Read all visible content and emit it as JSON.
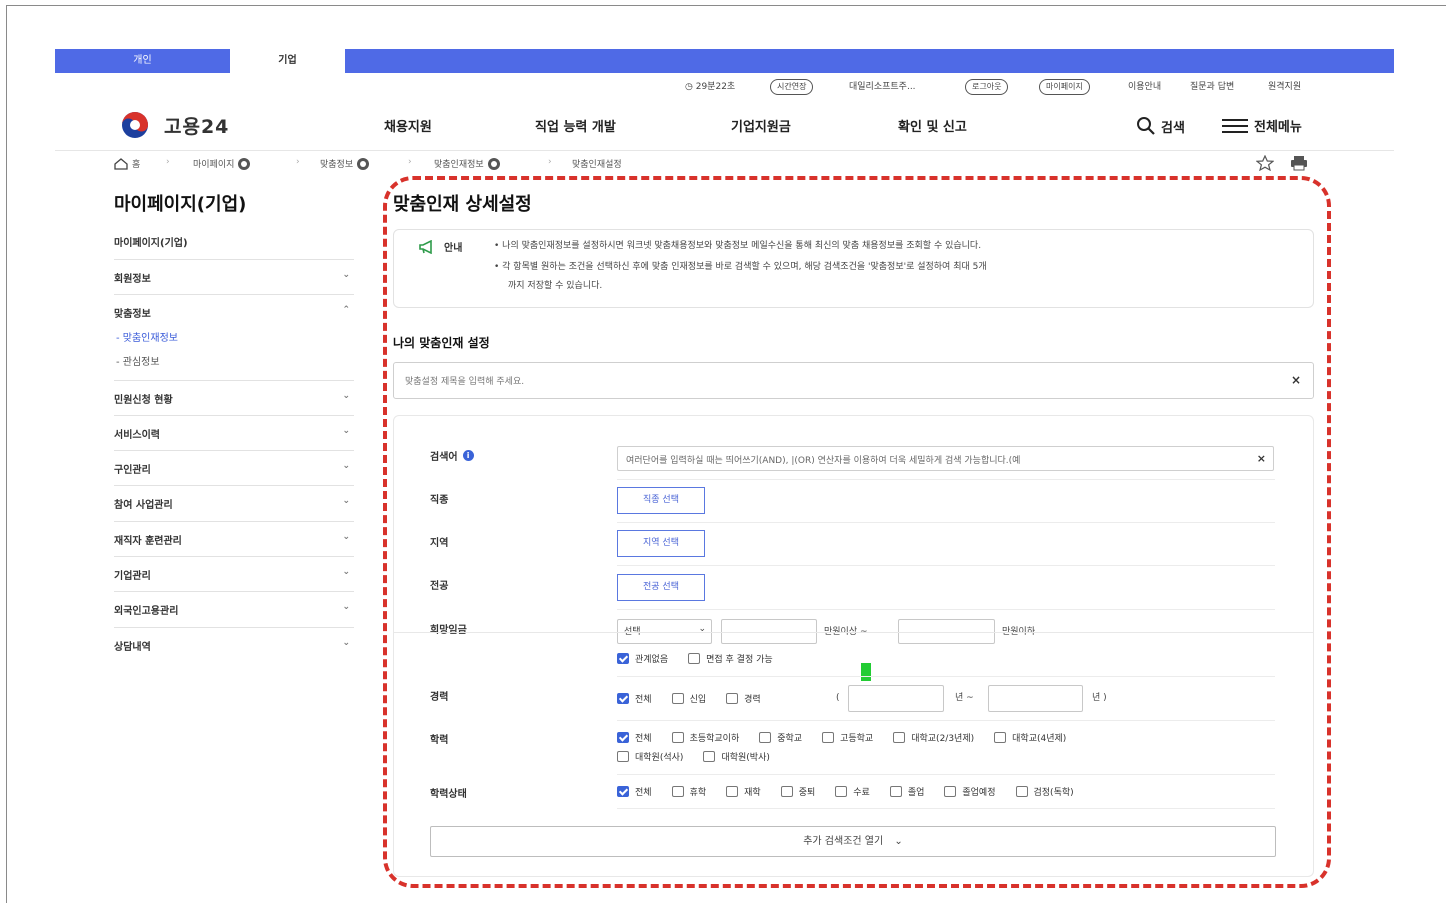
{
  "tabs": {
    "personal": "개인",
    "company": "기업"
  },
  "utility": {
    "timer": "29분22초",
    "extend": "시간연장",
    "company_name": "대일리소프트주...",
    "logout": "로그아웃",
    "mypage": "마이페이지",
    "guide": "이용안내",
    "qna": "질문과 답변",
    "remote": "원격지원"
  },
  "header": {
    "logo_text": "고용24",
    "nav": [
      "채용지원",
      "직업 능력 개발",
      "기업지원금",
      "확인 및 신고"
    ],
    "search": "검색",
    "all_menu": "전체메뉴"
  },
  "breadcrumb": [
    "홈",
    "마이페이지",
    "맞춤정보",
    "맞춤인재정보",
    "맞춤인재설정"
  ],
  "sidebar": {
    "title": "마이페이지(기업)",
    "sub": "마이페이지(기업)",
    "items": [
      "회원정보",
      "맞춤정보",
      "민원신청 현황",
      "서비스이력",
      "구인관리",
      "참여 사업관리",
      "재직자 훈련관리",
      "기업관리",
      "외국인고용관리",
      "상담내역"
    ],
    "children": [
      "- 맞춤인재정보",
      "- 관심정보"
    ]
  },
  "main": {
    "title": "맞춤인재 상세설정",
    "notice_label": "안내",
    "notice_lines": [
      "• 나의 맞춤인재정보를 설정하시면 워크넷 맞춤채용정보와 맞춤정보 메일수신을 통해 최신의 맞춤 채용정보를 조회할 수 있습니다.",
      "• 각 항목별 원하는 조건을 선택하신 후에 맞춤 인재정보를 바로 검색할 수 있으며, 해당 검색조건을 '맞춤정보'로 설정하여 최대 5개",
      "까지 저장할 수 있습니다."
    ],
    "section_title": "나의 맞춤인재 설정",
    "title_placeholder": "맞춤설정 제목을 입력해 주세요.",
    "labels": {
      "keyword": "검색어",
      "job": "직종",
      "region": "지역",
      "major": "전공",
      "salary": "희망임금",
      "career": "경력",
      "education": "학력",
      "edu_status": "학력상태"
    },
    "keyword_placeholder": "여러단어를 입력하실 때는 띄어쓰기(AND), |(OR) 연산자를 이용하여 더욱 세밀하게 검색 가능합니다.(예",
    "job_btn": "직종 선택",
    "region_btn": "지역 선택",
    "major_btn": "전공 선택",
    "salary": {
      "select": "선택",
      "from_suffix": "만원이상 ~",
      "to_suffix": "만원이하"
    },
    "salary_checks": [
      {
        "label": "관계없음",
        "checked": true
      },
      {
        "label": "면접 후 결정 가능",
        "checked": false
      }
    ],
    "career_checks": [
      {
        "label": "전체",
        "checked": true
      },
      {
        "label": "신입",
        "checked": false
      },
      {
        "label": "경력",
        "checked": false
      }
    ],
    "career_range": {
      "open": "(",
      "year1": "년 ~",
      "year2": "년 )"
    },
    "edu_checks": [
      {
        "label": "전체",
        "checked": true
      },
      {
        "label": "초등학교이하",
        "checked": false
      },
      {
        "label": "중학교",
        "checked": false
      },
      {
        "label": "고등학교",
        "checked": false
      },
      {
        "label": "대학교(2/3년제)",
        "checked": false
      },
      {
        "label": "대학교(4년제)",
        "checked": false
      },
      {
        "label": "대학원(석사)",
        "checked": false
      },
      {
        "label": "대학원(박사)",
        "checked": false
      }
    ],
    "status_checks": [
      {
        "label": "전체",
        "checked": true
      },
      {
        "label": "휴학",
        "checked": false
      },
      {
        "label": "재학",
        "checked": false
      },
      {
        "label": "중퇴",
        "checked": false
      },
      {
        "label": "수료",
        "checked": false
      },
      {
        "label": "졸업",
        "checked": false
      },
      {
        "label": "졸업예정",
        "checked": false
      },
      {
        "label": "검정(독학)",
        "checked": false
      }
    ],
    "more_btn": "추가 검색조건 열기"
  },
  "colors": {
    "brand": "#4f6ae6",
    "accent": "#3a63d8",
    "highlight": "#d8322b"
  }
}
